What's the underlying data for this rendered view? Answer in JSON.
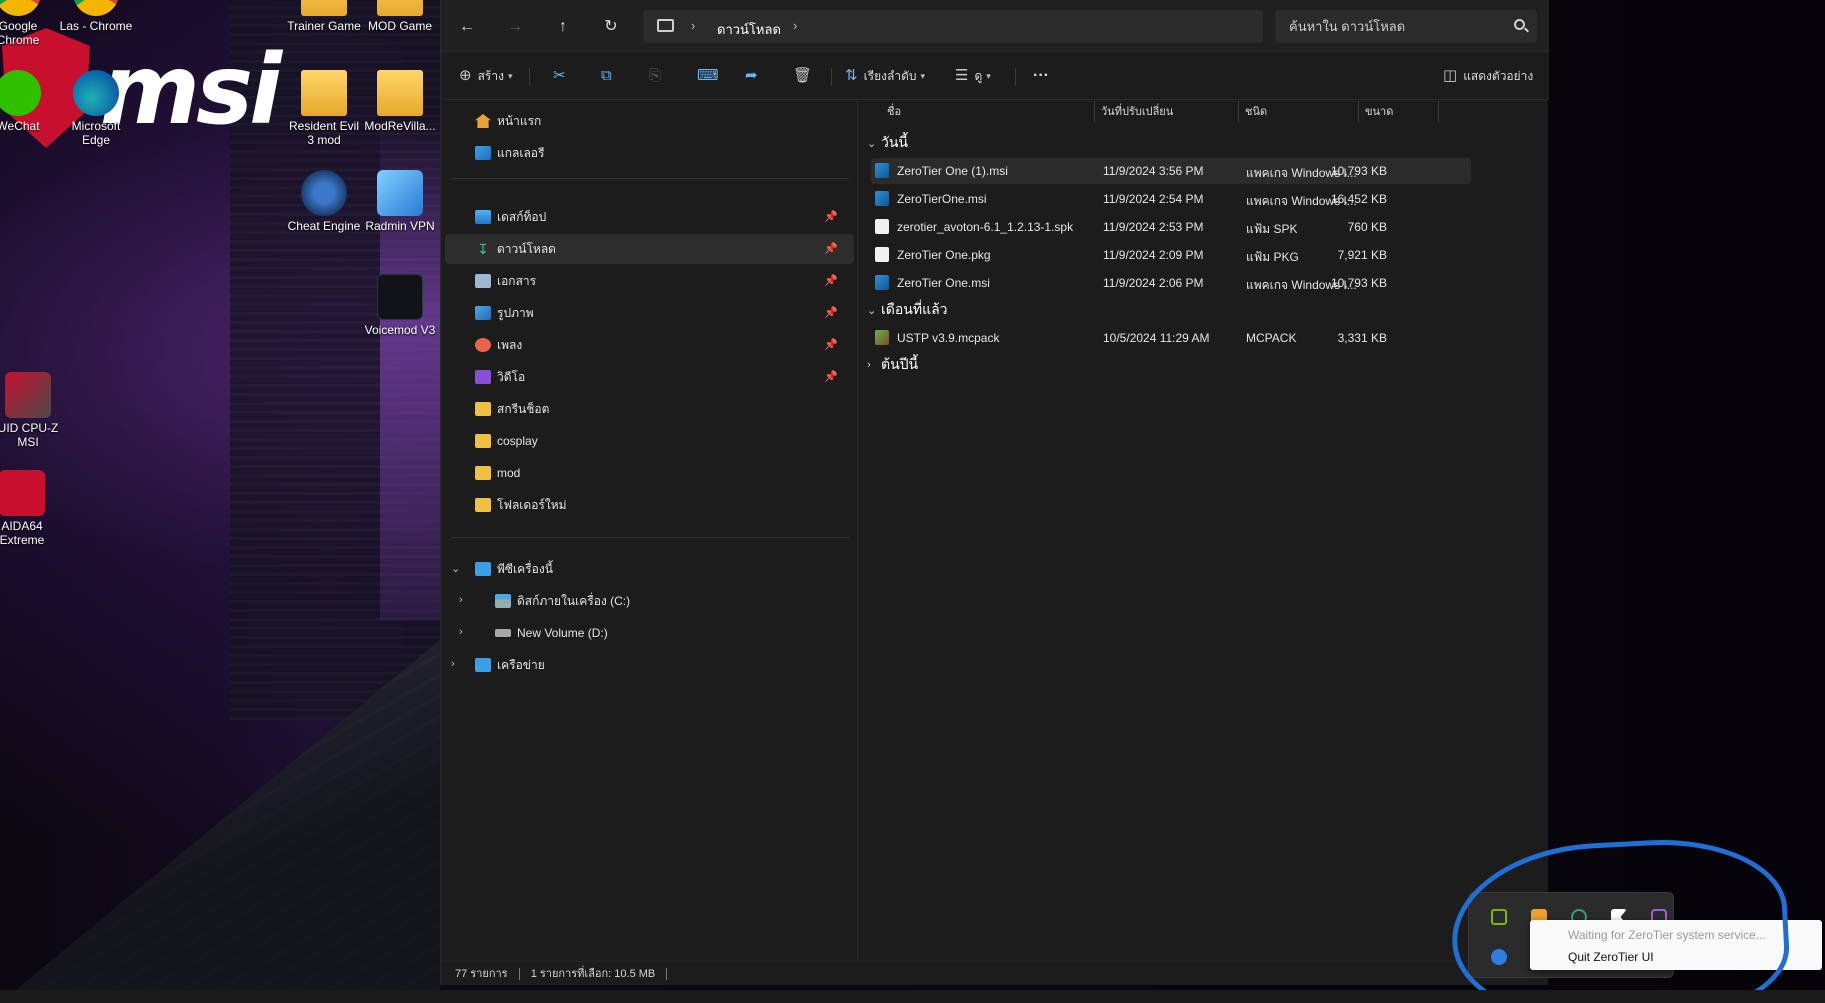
{
  "desktop": {
    "icons": [
      {
        "label": "Google Chrome"
      },
      {
        "label": "Las - Chrome"
      },
      {
        "label": "Trainer Game"
      },
      {
        "label": "MOD Game"
      },
      {
        "label": "WeChat"
      },
      {
        "label": "Microsoft Edge"
      },
      {
        "label": "Resident Evil 3 mod"
      },
      {
        "label": "ModReVilla..."
      },
      {
        "label": "Cheat Engine"
      },
      {
        "label": "Radmin VPN"
      },
      {
        "label": "Voicemod V3"
      },
      {
        "label": "UID CPU-Z MSI"
      },
      {
        "label": "AIDA64 Extreme"
      }
    ],
    "wallpaper_logo": "msi"
  },
  "explorer": {
    "breadcrumb": {
      "current": "ดาวน์โหลด"
    },
    "search": {
      "placeholder": "ค้นหาใน ดาวน์โหลด"
    },
    "toolbar": {
      "new_label": "สร้าง",
      "sort_label": "เรียงลำดับ",
      "view_label": "ดู",
      "more_label": "···",
      "preview_label": "แสดงตัวอย่าง"
    },
    "nav": {
      "home": "หน้าแรก",
      "gallery": "แกลเลอรี",
      "quick": [
        {
          "label": "เดสก์ท็อป",
          "pinned": true
        },
        {
          "label": "ดาวน์โหลด",
          "pinned": true
        },
        {
          "label": "เอกสาร",
          "pinned": true
        },
        {
          "label": "รูปภาพ",
          "pinned": true
        },
        {
          "label": "เพลง",
          "pinned": true
        },
        {
          "label": "วิดีโอ",
          "pinned": true
        },
        {
          "label": "สกรีนช็อต",
          "pinned": false
        },
        {
          "label": "cosplay",
          "pinned": false
        },
        {
          "label": "mod",
          "pinned": false
        },
        {
          "label": "โฟลเดอร์ใหม่",
          "pinned": false
        }
      ],
      "this_pc": "พีซีเครื่องนี้",
      "drive_c": "ดิสก์ภายในเครื่อง (C:)",
      "drive_d": "New Volume (D:)",
      "network": "เครือข่าย"
    },
    "columns": {
      "name": "ชื่อ",
      "date": "วันที่ปรับเปลี่ยน",
      "type": "ชนิด",
      "size": "ขนาด"
    },
    "groups": [
      {
        "label": "วันนี้",
        "files": [
          {
            "name": "ZeroTier One (1).msi",
            "date": "11/9/2024 3:56 PM",
            "type": "แพคเกจ Windows I...",
            "size": "10,793 KB",
            "icon": "msi-installer-icon"
          },
          {
            "name": "ZeroTierOne.msi",
            "date": "11/9/2024 2:54 PM",
            "type": "แพคเกจ Windows I...",
            "size": "16,452 KB",
            "icon": "msi-installer-icon"
          },
          {
            "name": "zerotier_avoton-6.1_1.2.13-1.spk",
            "date": "11/9/2024 2:53 PM",
            "type": "แฟ้ม SPK",
            "size": "760 KB",
            "icon": "document-icon"
          },
          {
            "name": "ZeroTier One.pkg",
            "date": "11/9/2024 2:09 PM",
            "type": "แฟ้ม PKG",
            "size": "7,921 KB",
            "icon": "document-icon"
          },
          {
            "name": "ZeroTier One.msi",
            "date": "11/9/2024 2:06 PM",
            "type": "แพคเกจ Windows I...",
            "size": "10,793 KB",
            "icon": "msi-installer-icon"
          }
        ]
      },
      {
        "label": "เดือนที่แล้ว",
        "files": [
          {
            "name": "USTP v3.9.mcpack",
            "date": "10/5/2024 11:29 AM",
            "type": "MCPACK",
            "size": "3,331 KB",
            "icon": "mcpack-icon"
          }
        ]
      },
      {
        "label": "ต้นปีนี้",
        "files": []
      }
    ],
    "status": {
      "count": "77 รายการ",
      "selection": "1 รายการที่เลือก: 10.5 MB"
    }
  },
  "tray": {
    "menu": {
      "status_item": "Waiting for ZeroTier system service...",
      "quit_item": "Quit ZeroTier UI"
    },
    "colors": {
      "annotation": "#1f6fd6",
      "accent": "#6ab7f5"
    }
  }
}
